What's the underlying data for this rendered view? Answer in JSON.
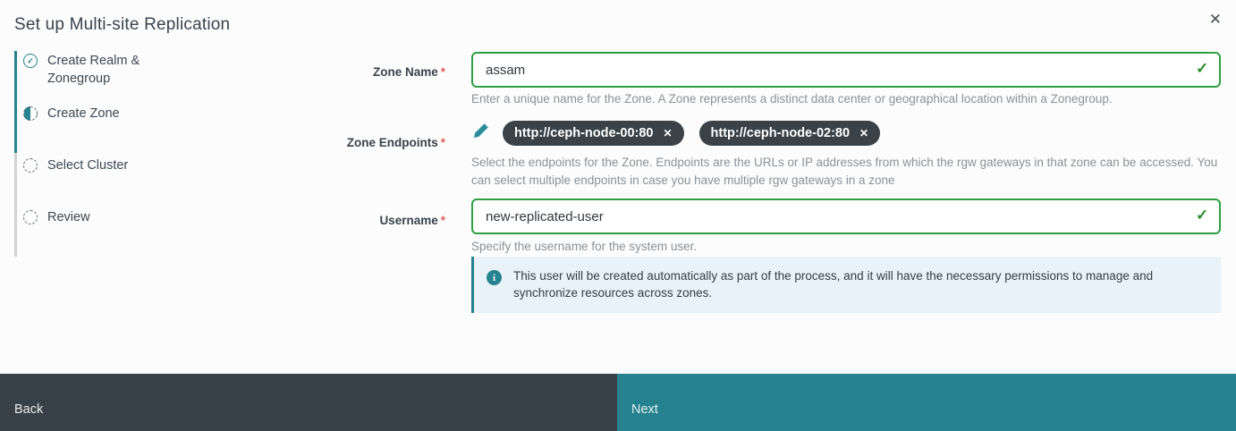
{
  "dialog": {
    "title": "Set up Multi-site Replication"
  },
  "icons": {
    "close": "✕",
    "check": "✓",
    "chip_remove": "✕",
    "info": "i"
  },
  "steps": [
    {
      "label": "Create Realm & Zonegroup",
      "state": "complete"
    },
    {
      "label": "Create Zone",
      "state": "active"
    },
    {
      "label": "Select Cluster",
      "state": "pending"
    },
    {
      "label": "Review",
      "state": "pending"
    }
  ],
  "form": {
    "zone_name": {
      "label": "Zone Name",
      "required": "*",
      "value": "assam",
      "helper": "Enter a unique name for the Zone. A Zone represents a distinct data center or geographical location within a Zonegroup."
    },
    "zone_endpoints": {
      "label": "Zone Endpoints",
      "required": "*",
      "chips": [
        "http://ceph-node-00:80",
        "http://ceph-node-02:80"
      ],
      "helper": "Select the endpoints for the Zone. Endpoints are the URLs or IP addresses from which the rgw gateways in that zone can be accessed. You can select multiple endpoints in case you have multiple rgw gateways in a zone"
    },
    "username": {
      "label": "Username",
      "required": "*",
      "value": "new-replicated-user",
      "helper": "Specify the username for the system user."
    }
  },
  "alert": {
    "text": "This user will be created automatically as part of the process, and it will have the necessary permissions to manage and synchronize resources across zones."
  },
  "footer": {
    "back_label": "Back",
    "next_label": "Next"
  },
  "colors": {
    "accent_teal": "#26838f",
    "valid_green": "#2f9e44",
    "chip_bg": "#3a4248",
    "alert_bg": "#e9f1f9",
    "footer_back_bg": "#374147",
    "footer_next_bg": "#26828e",
    "required_red": "#e4605e"
  }
}
